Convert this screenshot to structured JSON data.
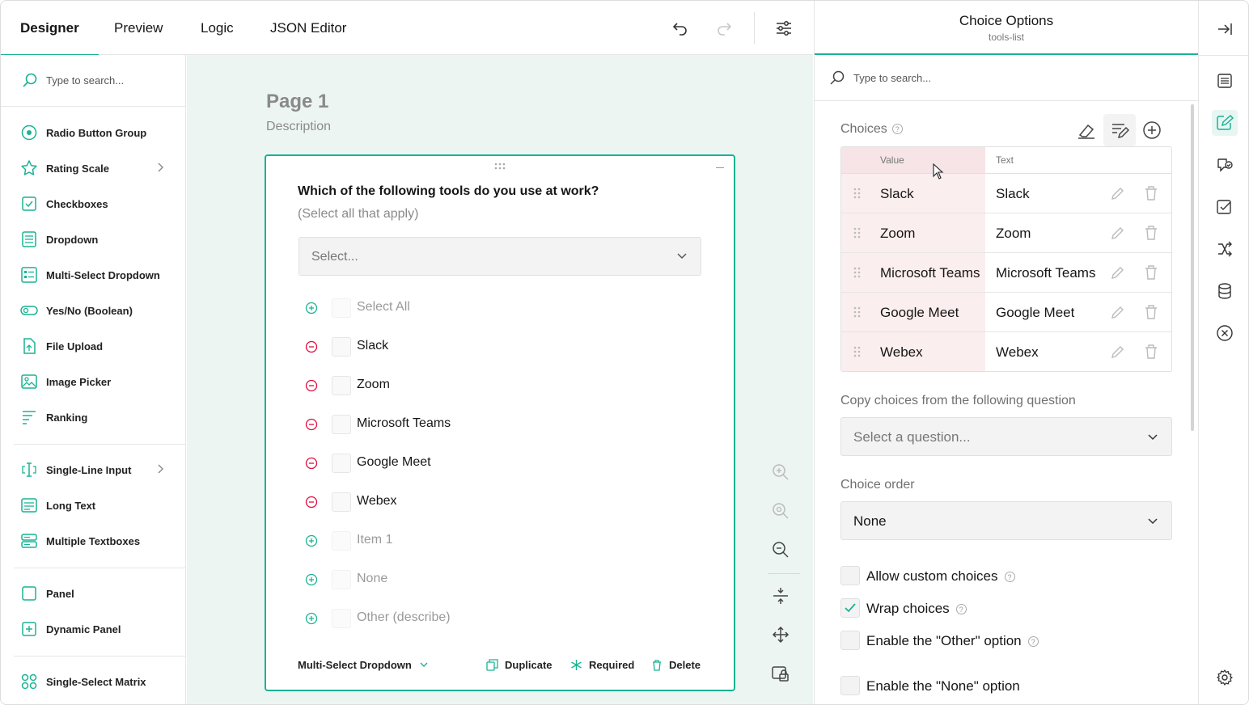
{
  "tabs": [
    {
      "label": "Designer",
      "active": true
    },
    {
      "label": "Preview"
    },
    {
      "label": "Logic"
    },
    {
      "label": "JSON Editor"
    }
  ],
  "toolbar": {
    "undo_icon": "undo-icon",
    "redo_icon": "redo-icon",
    "settings_icon": "sliders-icon"
  },
  "toolbox": {
    "search_placeholder": "Type to search...",
    "items": [
      {
        "label": "Radio Button Group",
        "icon": "radio-icon"
      },
      {
        "label": "Rating Scale",
        "icon": "star-icon",
        "has_submenu": true
      },
      {
        "label": "Checkboxes",
        "icon": "checkbox-icon"
      },
      {
        "label": "Dropdown",
        "icon": "dropdown-icon"
      },
      {
        "label": "Multi-Select Dropdown",
        "icon": "multiselect-icon"
      },
      {
        "label": "Yes/No (Boolean)",
        "icon": "toggle-icon"
      },
      {
        "label": "File Upload",
        "icon": "file-upload-icon"
      },
      {
        "label": "Image Picker",
        "icon": "image-icon"
      },
      {
        "label": "Ranking",
        "icon": "ranking-icon"
      },
      {
        "label": "Single-Line Input",
        "icon": "text-input-icon",
        "has_submenu": true
      },
      {
        "label": "Long Text",
        "icon": "long-text-icon"
      },
      {
        "label": "Multiple Textboxes",
        "icon": "multiple-text-icon"
      },
      {
        "label": "Panel",
        "icon": "panel-icon"
      },
      {
        "label": "Dynamic Panel",
        "icon": "dynamic-panel-icon"
      },
      {
        "label": "Single-Select Matrix",
        "icon": "matrix-icon"
      }
    ]
  },
  "page": {
    "title": "Page 1",
    "description": "Description"
  },
  "question": {
    "title": "Which of the following tools do you use at work?",
    "subtitle": "(Select all that apply)",
    "select_placeholder": "Select...",
    "choices": [
      {
        "label": "Select All",
        "state": "ghost"
      },
      {
        "label": "Slack",
        "state": "active"
      },
      {
        "label": "Zoom",
        "state": "active"
      },
      {
        "label": "Microsoft Teams",
        "state": "active"
      },
      {
        "label": "Google Meet",
        "state": "active"
      },
      {
        "label": "Webex",
        "state": "active"
      },
      {
        "label": "Item 1",
        "state": "ghost"
      },
      {
        "label": "None",
        "state": "ghost"
      },
      {
        "label": "Other (describe)",
        "state": "ghost"
      }
    ],
    "footer": {
      "type": "Multi-Select Dropdown",
      "duplicate": "Duplicate",
      "required": "Required",
      "delete": "Delete"
    }
  },
  "properties": {
    "title": "Choice Options",
    "subtitle": "tools-list",
    "search_placeholder": "Type to search...",
    "choices_label": "Choices",
    "table_headers": {
      "value": "Value",
      "text": "Text"
    },
    "rows": [
      {
        "value": "Slack",
        "text": "Slack"
      },
      {
        "value": "Zoom",
        "text": "Zoom"
      },
      {
        "value": "Microsoft Teams",
        "text": "Microsoft Teams"
      },
      {
        "value": "Google Meet",
        "text": "Google Meet"
      },
      {
        "value": "Webex",
        "text": "Webex"
      }
    ],
    "copy_label": "Copy choices from the following question",
    "copy_placeholder": "Select a question...",
    "order_label": "Choice order",
    "order_value": "None",
    "checkboxes": [
      {
        "label": "Allow custom choices",
        "checked": false,
        "help": true
      },
      {
        "label": "Wrap choices",
        "checked": true,
        "help": true
      },
      {
        "label": "Enable the \"Other\" option",
        "checked": false,
        "help": true
      },
      {
        "label": "Enable the \"None\" option",
        "checked": false,
        "help": false
      }
    ]
  },
  "colors": {
    "accent": "#19b394",
    "remove": "#e50a3e",
    "canvas_bg": "#edf5f3"
  }
}
